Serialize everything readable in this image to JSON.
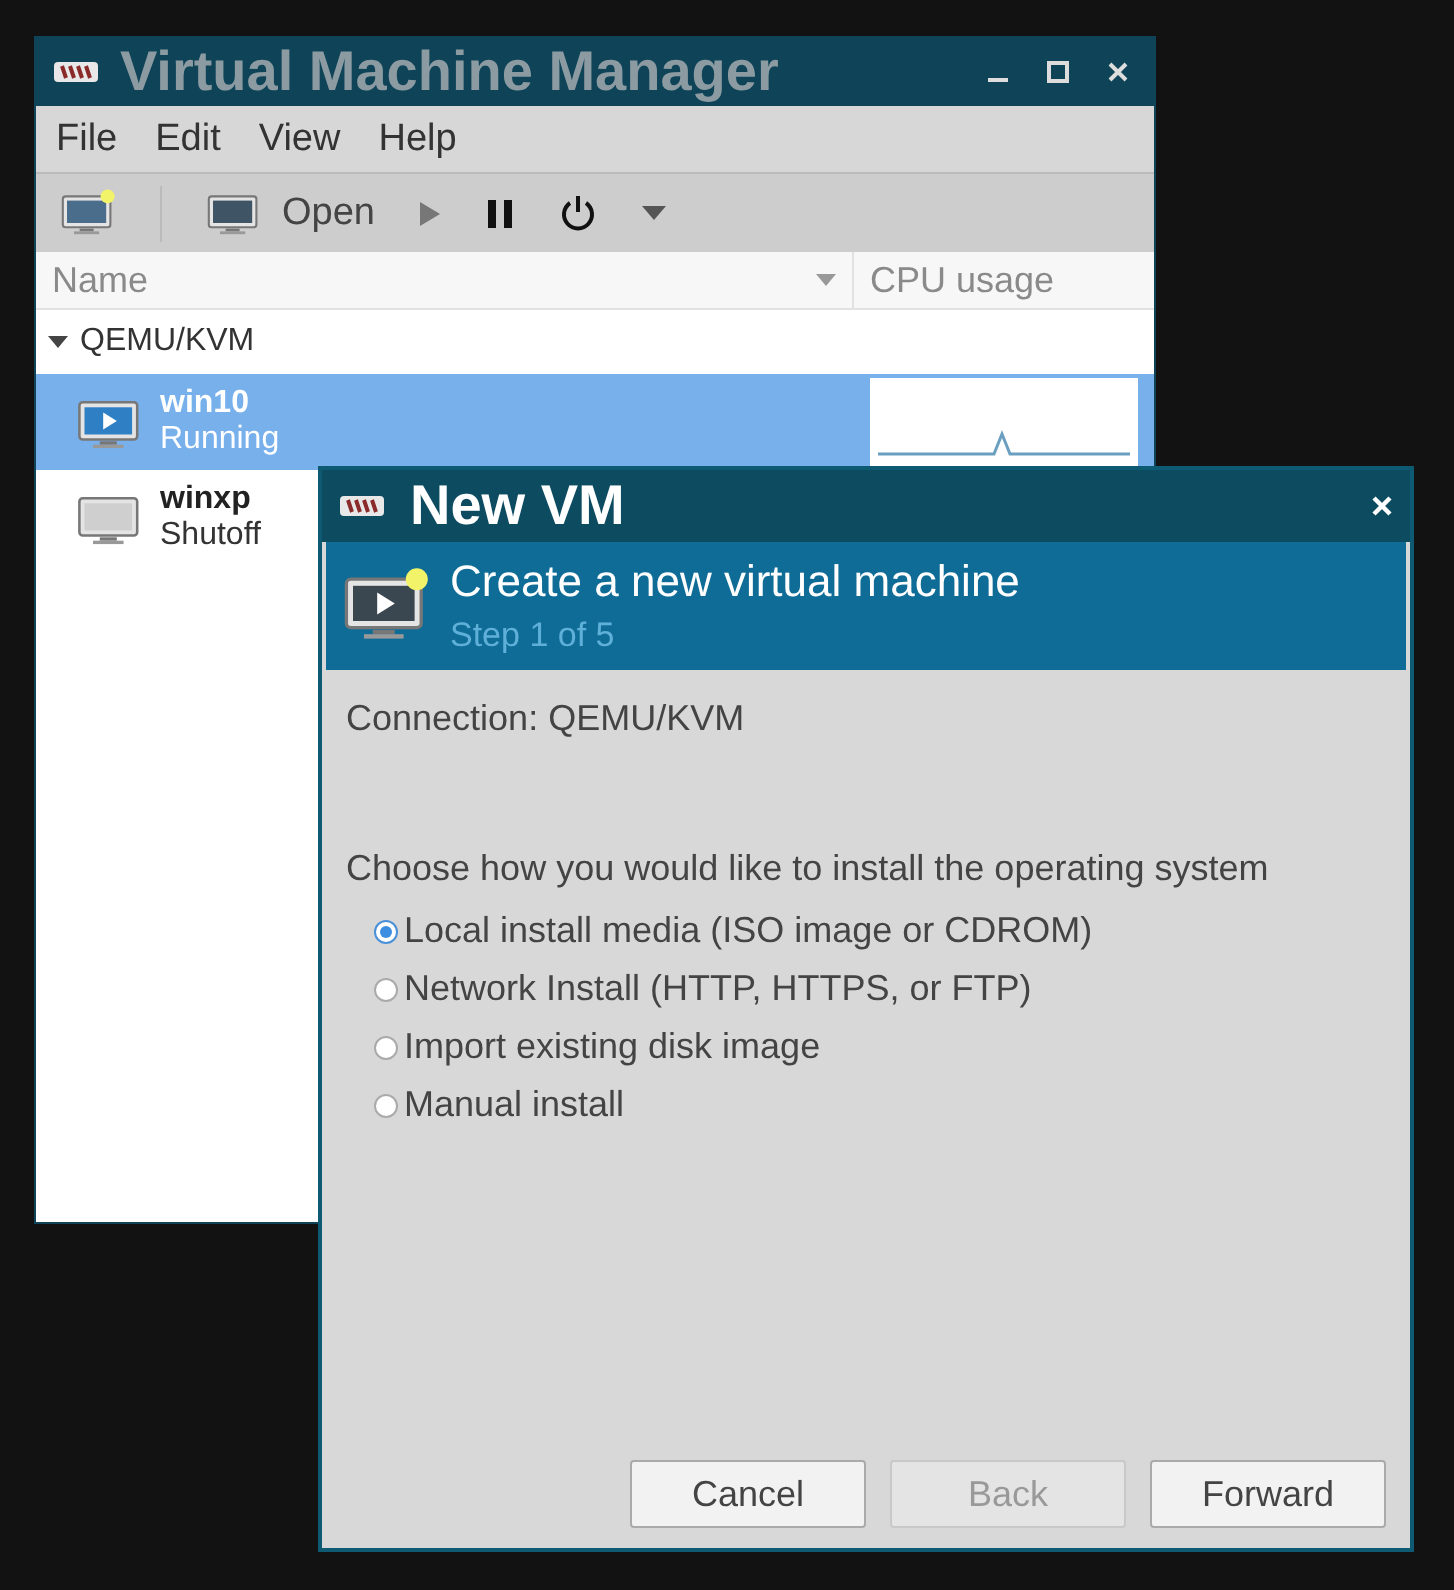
{
  "main_window": {
    "title": "Virtual Machine Manager",
    "menu": [
      "File",
      "Edit",
      "View",
      "Help"
    ],
    "toolbar": [
      {
        "kind": "new"
      },
      {
        "kind": "open",
        "label": "Open"
      },
      {
        "kind": "run"
      },
      {
        "kind": "pause"
      },
      {
        "kind": "power"
      },
      {
        "kind": "dropdown"
      }
    ],
    "columns": [
      "Name",
      "CPU usage"
    ],
    "tree": [
      {
        "label": "QEMU/KVM",
        "expanded": true,
        "children": [
          {
            "name": "win10",
            "status": "Running",
            "running": true,
            "selected": true
          },
          {
            "name": "winxp",
            "status": "Shutoff",
            "running": false,
            "selected": false
          }
        ]
      }
    ]
  },
  "dialog": {
    "title": "New VM",
    "header_title": "Create a new virtual machine",
    "header_step": "Step 1 of 5",
    "connection": "Connection: QEMU/KVM",
    "prompt": "Choose how you would like to install the operating system",
    "options": [
      {
        "label": "Local install media (ISO image or CDROM)",
        "selected": true
      },
      {
        "label": "Network Install (HTTP, HTTPS, or FTP)",
        "selected": false
      },
      {
        "label": "Import existing disk image",
        "selected": false
      },
      {
        "label": "Manual install",
        "selected": false
      }
    ],
    "buttons": [
      {
        "label": "Cancel",
        "disabled": false
      },
      {
        "label": "Back",
        "disabled": true
      },
      {
        "label": "Forward",
        "disabled": false
      }
    ]
  }
}
